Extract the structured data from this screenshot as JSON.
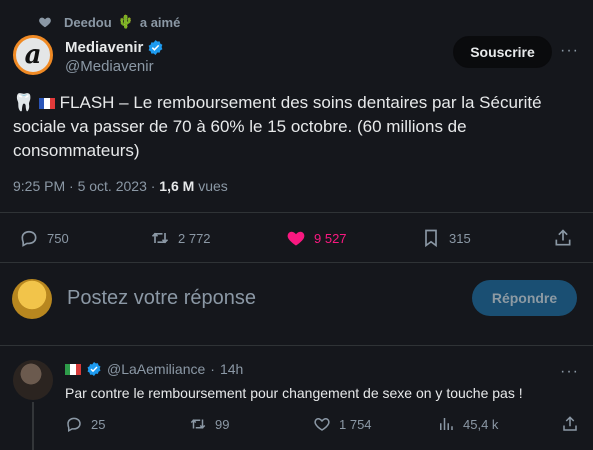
{
  "social_context": {
    "user": "Deedou",
    "emoji": "🌵",
    "action": "a aimé"
  },
  "tweet": {
    "author_name": "Mediavenir",
    "author_handle": "@Mediavenir",
    "avatar_letter": "a",
    "follow_label": "Souscrire",
    "more_label": "···",
    "emoji_prefix": "🦷",
    "text": "FLASH – Le remboursement des soins dentaires par la Sécurité sociale va passer de 70 à 60% le 15 octobre. (60 millions de consommateurs)",
    "timestamp": "9:25 PM · 5 oct. 2023 · ",
    "views_count": "1,6 M",
    "views_label": " vues",
    "stats": {
      "replies": "750",
      "retweets": "2 772",
      "likes": "9 527",
      "bookmarks": "315"
    }
  },
  "reply_box": {
    "placeholder": "Postez votre réponse",
    "button_label": "Répondre"
  },
  "comment": {
    "handle": "@LaAemiliance",
    "separator": "·",
    "time": "14h",
    "text": "Par contre le remboursement pour changement de sexe on y touche pas !",
    "stats": {
      "replies": "25",
      "retweets": "99",
      "likes": "1 754",
      "views": "45,4 k"
    },
    "more_label": "···"
  },
  "colors": {
    "like_active": "#f91880",
    "verified": "#1d9bf0",
    "background": "#15171c"
  }
}
